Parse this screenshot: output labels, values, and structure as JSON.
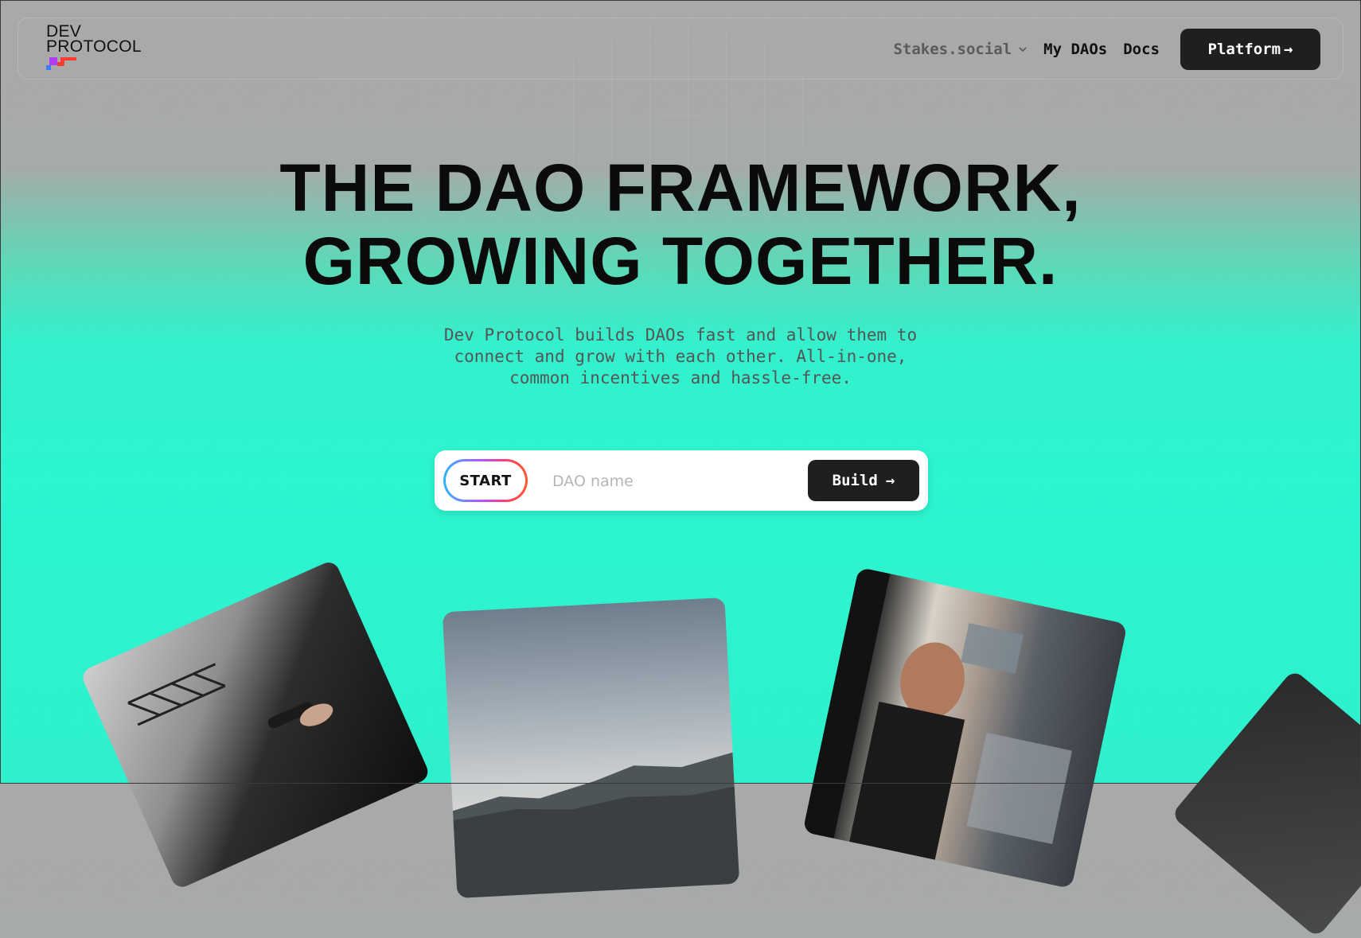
{
  "brand": {
    "line1": "DEV",
    "line2": "PROTOCOL",
    "colors": {
      "magenta": "#b23cf0",
      "red": "#ff3b2f",
      "blue": "#3a7bff"
    }
  },
  "nav": {
    "items": [
      {
        "label": "Stakes.social",
        "has_dropdown": true
      },
      {
        "label": "My DAOs"
      },
      {
        "label": "Docs"
      }
    ],
    "cta_label": "Platform",
    "cta_arrow": "→"
  },
  "hero": {
    "headline_line1": "THE DAO FRAMEWORK,",
    "headline_line2": "GROWING TOGETHER.",
    "subtitle_line1": "Dev Protocol builds DAOs fast and allow them to",
    "subtitle_line2": "connect and grow with each other. All-in-one,",
    "subtitle_line3": "common incentives and hassle-free."
  },
  "build_form": {
    "start_label": "START",
    "input_value": "",
    "input_placeholder": "DAO name",
    "button_label": "Build",
    "button_arrow": "→"
  },
  "gallery": {
    "cards": [
      {
        "subject": "performer-with-microphone-on-stage"
      },
      {
        "subject": "mountain-landscape-sky"
      },
      {
        "subject": "man-working-in-workshop"
      },
      {
        "subject": "dark-abstract-texture"
      }
    ]
  },
  "theme": {
    "accent_teal": "#2ef5d0",
    "dark": "#1f1f1f"
  }
}
